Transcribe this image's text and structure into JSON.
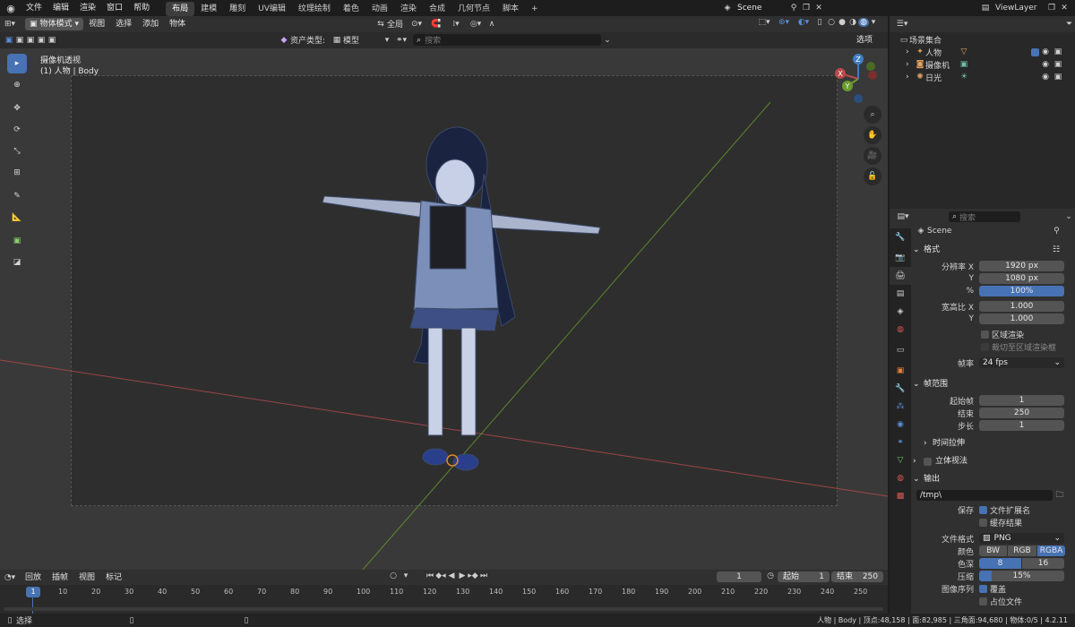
{
  "topbar": {
    "menus": [
      "文件",
      "编辑",
      "渲染",
      "窗口",
      "帮助"
    ],
    "workspaces": [
      "布局",
      "建模",
      "雕刻",
      "UV编辑",
      "纹理绘制",
      "着色",
      "动画",
      "渲染",
      "合成",
      "几何节点",
      "脚本"
    ],
    "active_workspace": "布局",
    "scene": "Scene",
    "view_layer": "ViewLayer"
  },
  "viewport_header": {
    "mode": "物体模式",
    "menus": [
      "视图",
      "选择",
      "添加",
      "物体"
    ],
    "transform_orientation": "全局",
    "asset_type_label": "资产类型:",
    "asset_type_value": "模型",
    "search_placeholder": "搜索",
    "options": "选项"
  },
  "viewport": {
    "view_name": "摄像机透视",
    "object_info": "(1) 人物 | Body",
    "gizmo": {
      "x": "X",
      "y": "Y",
      "z": "Z"
    },
    "colors": {
      "x_axis": "#b84a4a",
      "y_axis": "#6a9a2e",
      "z_axis": "#3f7ec0"
    }
  },
  "outliner": {
    "root": "场景集合",
    "items": [
      {
        "name": "人物",
        "icon": "armature-icon"
      },
      {
        "name": "摄像机",
        "icon": "camera-icon"
      },
      {
        "name": "日光",
        "icon": "light-icon"
      }
    ]
  },
  "properties": {
    "search_placeholder": "搜索",
    "context": "Scene",
    "format": {
      "title": "格式",
      "resolution_x_label": "分辨率 X",
      "resolution_x": "1920 px",
      "resolution_y_label": "Y",
      "resolution_y": "1080 px",
      "percent_label": "%",
      "percent": "100%",
      "aspect_x_label": "宽高比 X",
      "aspect_x": "1.000",
      "aspect_y_label": "Y",
      "aspect_y": "1.000",
      "region_render": "区域渲染",
      "crop_region": "裁切至区域渲染框",
      "framerate_label": "帧率",
      "framerate": "24 fps"
    },
    "frame_range": {
      "title": "帧范围",
      "start_label": "起始帧",
      "start": "1",
      "end_label": "结束",
      "end": "250",
      "step_label": "步长",
      "step": "1",
      "time_stretch": "时间拉伸"
    },
    "stereoscopy": "立体视法",
    "output": {
      "title": "输出",
      "path": "/tmp\\",
      "save_label": "保存",
      "file_ext": "文件扩展名",
      "cache_result": "缓存结果",
      "file_format_label": "文件格式",
      "file_format": "PNG",
      "color_label": "颜色",
      "color_options": [
        "BW",
        "RGB",
        "RGBA"
      ],
      "color_selected": "RGBA",
      "depth_label": "色深",
      "depth_options": [
        "8",
        "16"
      ],
      "depth_selected": "8",
      "compression_label": "压缩",
      "compression": "15%",
      "compression_fraction": 0.15,
      "image_sequence_label": "图像序列",
      "overwrite": "覆盖",
      "placeholders": "占位文件"
    }
  },
  "timeline": {
    "menus": [
      "回放",
      "插帧",
      "视图",
      "标记"
    ],
    "current_frame": "1",
    "start_label": "起始",
    "start": "1",
    "end_label": "结束",
    "end": "250",
    "ticks": [
      "10",
      "20",
      "30",
      "40",
      "50",
      "60",
      "70",
      "80",
      "90",
      "100",
      "110",
      "120",
      "130",
      "140",
      "150",
      "160",
      "170",
      "180",
      "190",
      "200",
      "210",
      "220",
      "230",
      "240",
      "250"
    ],
    "playhead": "1"
  },
  "statusbar": {
    "left": "选择",
    "stats": "人物 | Body | 顶点:48,158 | 面:82,985 | 三角面:94,680 | 物体:0/5 | 4.2.11"
  }
}
